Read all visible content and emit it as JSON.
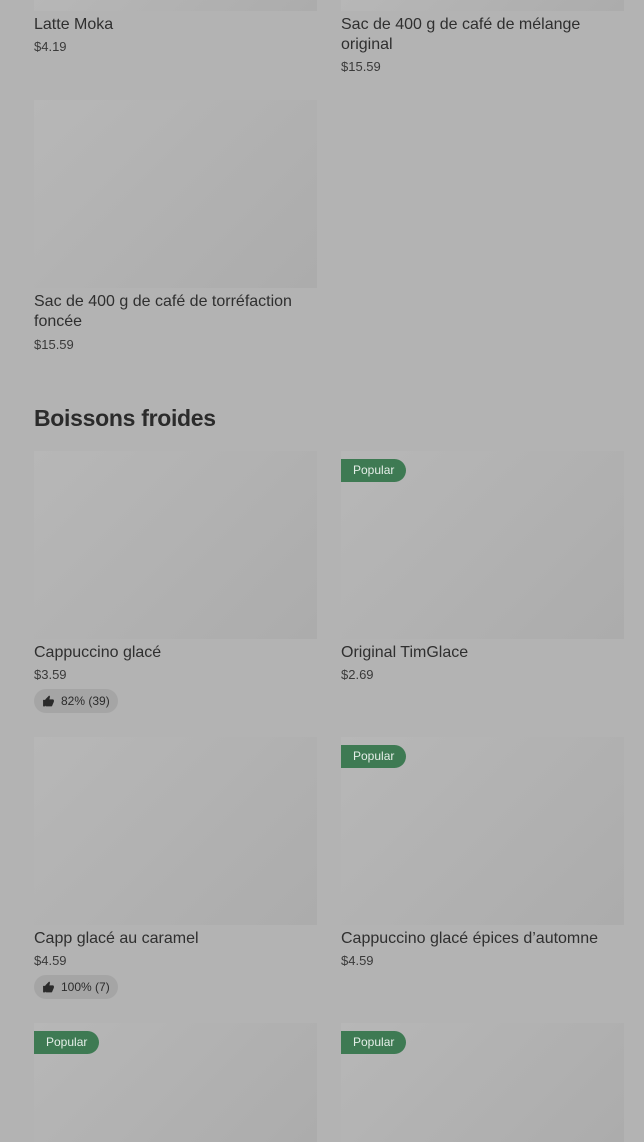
{
  "top_products": [
    {
      "name": "Latte Moka",
      "price": "$4.19"
    },
    {
      "name": "Sac de 400 g de café de mélange original",
      "price": "$15.59"
    },
    {
      "name": "Sac de 400 g de café de torréfaction foncée",
      "price": "$15.59"
    }
  ],
  "section": {
    "title": "Boissons froides"
  },
  "cold_drinks": [
    {
      "name": "Cappuccino glacé",
      "price": "$3.59",
      "rating": "82% (39)"
    },
    {
      "name": "Original TimGlace",
      "price": "$2.69",
      "badge": "Popular"
    },
    {
      "name": "Capp glacé au caramel",
      "price": "$4.59",
      "rating": "100% (7)"
    },
    {
      "name": "Cappuccino glacé épices d’automne",
      "price": "$4.59",
      "badge": "Popular"
    },
    {
      "badge": "Popular"
    },
    {
      "badge": "Popular"
    }
  ],
  "icons": {
    "rating": "thumbs-up-icon"
  }
}
